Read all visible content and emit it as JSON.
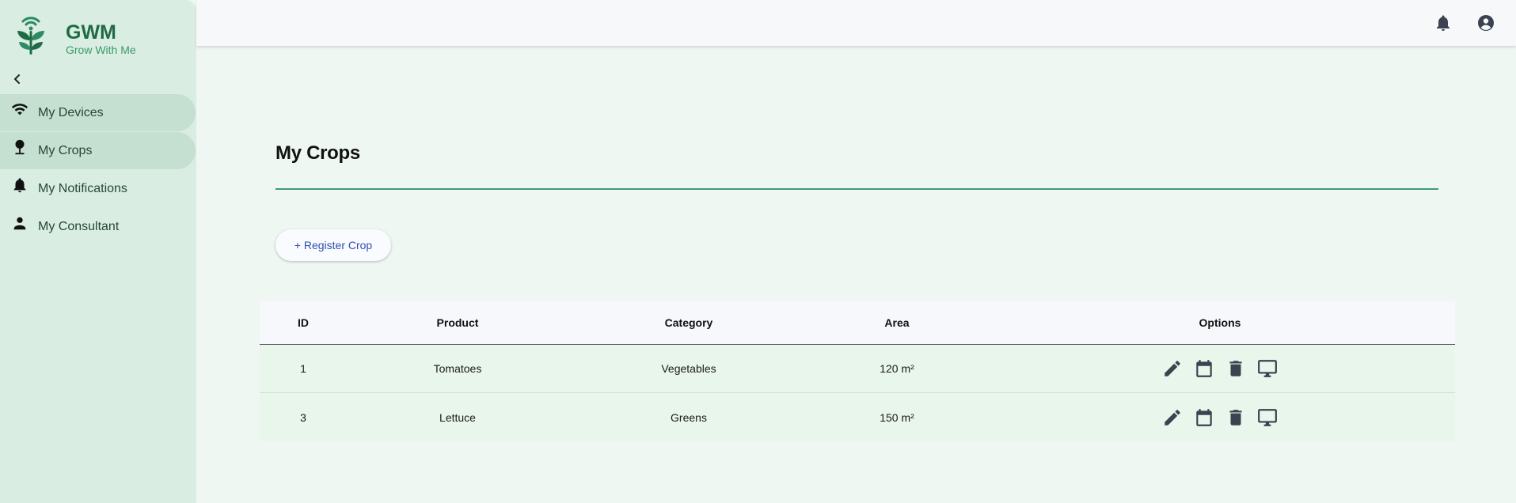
{
  "brand": {
    "name": "GWM",
    "tagline": "Grow With Me"
  },
  "sidebar": {
    "items": [
      {
        "label": "My Devices",
        "icon": "wifi-icon"
      },
      {
        "label": "My Crops",
        "icon": "plant-icon"
      },
      {
        "label": "My Notifications",
        "icon": "bell-icon"
      },
      {
        "label": "My Consultant",
        "icon": "person-icon"
      }
    ]
  },
  "topbar": {
    "icons": [
      "bell-icon",
      "account-circle-icon"
    ]
  },
  "page": {
    "title": "My Crops",
    "register_label": "+ Register Crop"
  },
  "table": {
    "headers": [
      "ID",
      "Product",
      "Category",
      "Area",
      "Options"
    ],
    "rows": [
      {
        "id": "1",
        "product": "Tomatoes",
        "category": "Vegetables",
        "area": "120 m²"
      },
      {
        "id": "3",
        "product": "Lettuce",
        "category": "Greens",
        "area": "150 m²"
      }
    ],
    "option_icons": [
      "edit-icon",
      "calendar-icon",
      "delete-icon",
      "monitor-icon"
    ]
  },
  "colors": {
    "accent": "#3f9a72",
    "brand": "#1f6b44",
    "sidebar_bg": "#d9ede2",
    "page_bg": "#eef7f2"
  }
}
